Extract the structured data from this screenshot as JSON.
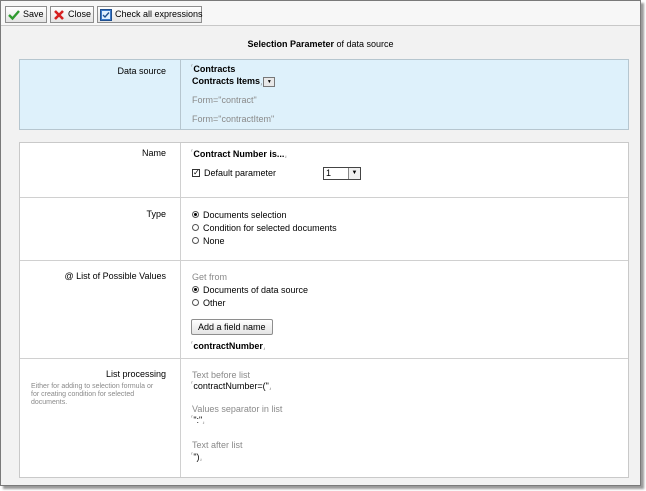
{
  "toolbar": {
    "save_label": "Save",
    "close_label": "Close",
    "check_label": "Check all expressions"
  },
  "heading": {
    "bold": "Selection Parameter",
    "rest": " of data source"
  },
  "data_source": {
    "label": "Data source",
    "line1": "Contracts",
    "line2": "Contracts Items",
    "form1": "Form=\"contract\"",
    "form2": "Form=\"contractItem\""
  },
  "name": {
    "label": "Name",
    "value": "Contract Number is...",
    "default_label": "Default parameter",
    "default_checked": true,
    "select_value": "1"
  },
  "type": {
    "label": "Type",
    "options": [
      {
        "label": "Documents selection",
        "selected": true
      },
      {
        "label": "Condition for selected documents",
        "selected": false
      },
      {
        "label": "None",
        "selected": false
      }
    ]
  },
  "values": {
    "label": "@ List of Possible Values",
    "get_from": "Get from",
    "options": [
      {
        "label": "Documents of data source",
        "selected": true
      },
      {
        "label": "Other",
        "selected": false
      }
    ],
    "add_field_label": "Add a field name",
    "field_value": "contractNumber"
  },
  "processing": {
    "label": "List processing",
    "help": "Either for adding to selection formula or for creating condition for selected documents.",
    "before_label": "Text before list",
    "before_value": "contractNumber=(\"",
    "separator_label": "Values separator in list",
    "separator_value": "\":\"",
    "after_label": "Text after list",
    "after_value": "\")"
  }
}
